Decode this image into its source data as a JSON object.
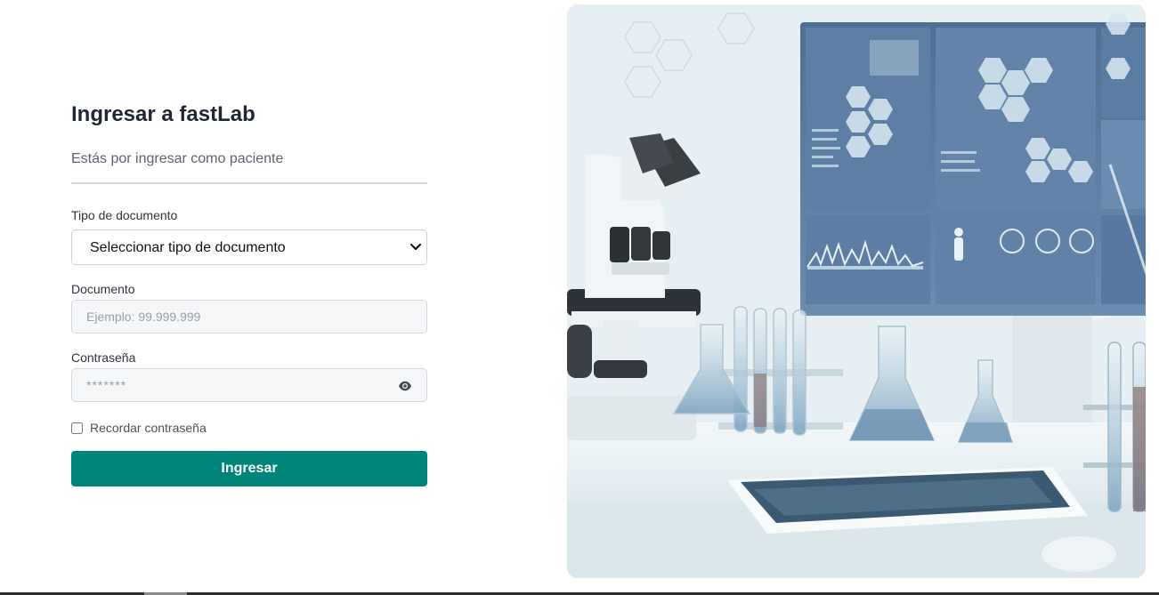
{
  "login": {
    "title": "Ingresar a fastLab",
    "subtitle": "Estás por ingresar como paciente",
    "doc_type": {
      "label": "Tipo de documento",
      "selected": "Seleccionar tipo de documento"
    },
    "document": {
      "label": "Documento",
      "placeholder": "Ejemplo: 99.999.999"
    },
    "password": {
      "label": "Contraseña",
      "value": "*******"
    },
    "remember_label": "Recordar contraseña",
    "submit_label": "Ingresar"
  },
  "colors": {
    "primary": "#00847a",
    "title": "#1f2733",
    "muted": "#5b6270"
  },
  "icons": {
    "select": "chevron-down-icon",
    "password_toggle": "eye-icon"
  },
  "hero": {
    "description_icon": "laboratory-illustration"
  }
}
